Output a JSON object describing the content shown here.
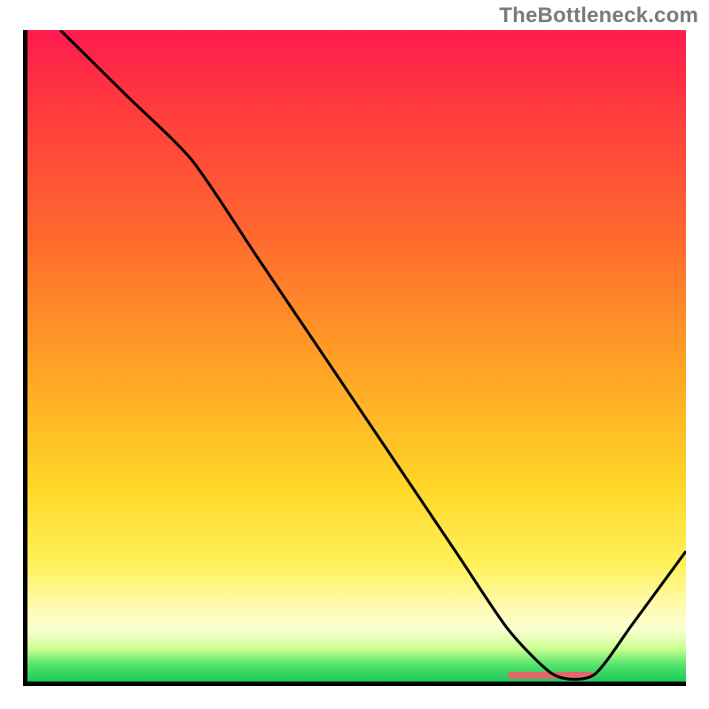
{
  "watermark": "TheBottleneck.com",
  "colors": {
    "red": "#ff1a4f",
    "orange": "#ffa325",
    "yellow": "#ffd627",
    "paleYellow": "#fffbb7",
    "green": "#1dc95a",
    "accent": "#e06969",
    "frame": "#000000"
  },
  "chart_data": {
    "type": "line",
    "title": "",
    "xlabel": "",
    "ylabel": "",
    "xlim": [
      0,
      100
    ],
    "ylim": [
      0,
      100
    ],
    "grid": false,
    "legend": false,
    "series": [
      {
        "name": "curve",
        "x": [
          5,
          15,
          25,
          35,
          45,
          55,
          65,
          73,
          80,
          86,
          92,
          100
        ],
        "y": [
          100,
          90,
          80,
          65,
          50,
          35,
          20,
          8,
          1,
          1,
          9,
          20
        ]
      }
    ],
    "accent_strip": {
      "x_start": 73,
      "x_end": 86,
      "y": 1
    }
  }
}
